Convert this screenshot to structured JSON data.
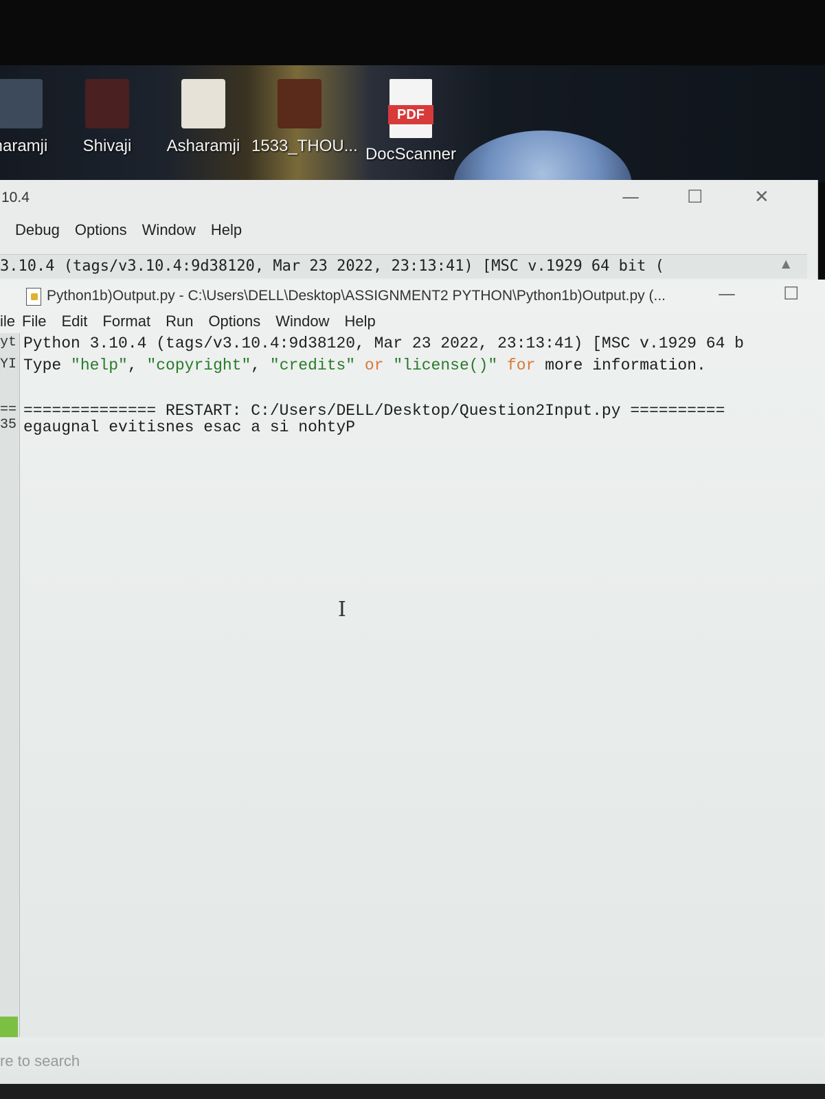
{
  "desktop": {
    "icons": [
      {
        "label": "haramji",
        "icon": "folder-icon"
      },
      {
        "label": "Shivaji",
        "icon": "shortcut-icon"
      },
      {
        "label": "Asharamji",
        "icon": "image-icon"
      },
      {
        "label": "1533_THOU...",
        "icon": "video-icon"
      },
      {
        "label": "DocScanner",
        "icon": "pdf-icon",
        "badge": "PDF"
      }
    ]
  },
  "back_window": {
    "title": "10.4",
    "menu": [
      "Debug",
      "Options",
      "Window",
      "Help"
    ],
    "shell_line": "3.10.4 (tags/v3.10.4:9d38120, Mar 23 2022, 23:13:41) [MSC v.1929 64 bit ("
  },
  "front_window": {
    "title": "Python1b)Output.py - C:\\Users\\DELL\\Desktop\\ASSIGNMENT2 PYTHON\\Python1b)Output.py (...",
    "menu": [
      "ile",
      "File",
      "Edit",
      "Format",
      "Run",
      "Options",
      "Window",
      "Help"
    ],
    "gutter": [
      "yt",
      "YI",
      "==",
      "35"
    ],
    "lines": {
      "banner": "Python 3.10.4 (tags/v3.10.4:9d38120, Mar 23 2022, 23:13:41) [MSC v.1929 64 b",
      "info_prefix": "Type ",
      "info_help": "\"help\"",
      "info_sep1": ", ",
      "info_copyright": "\"copyright\"",
      "info_sep2": ", ",
      "info_credits": "\"credits\"",
      "info_or": " or ",
      "info_license": "\"license()\"",
      "info_for": " for",
      "info_suffix": " more information.",
      "restart": "============== RESTART: C:/Users/DELL/Desktop/Question2Input.py ==========",
      "output": "egaugnal evitisnes esac a si nohtyP"
    }
  },
  "taskbar": {
    "search_placeholder": "re to search"
  }
}
